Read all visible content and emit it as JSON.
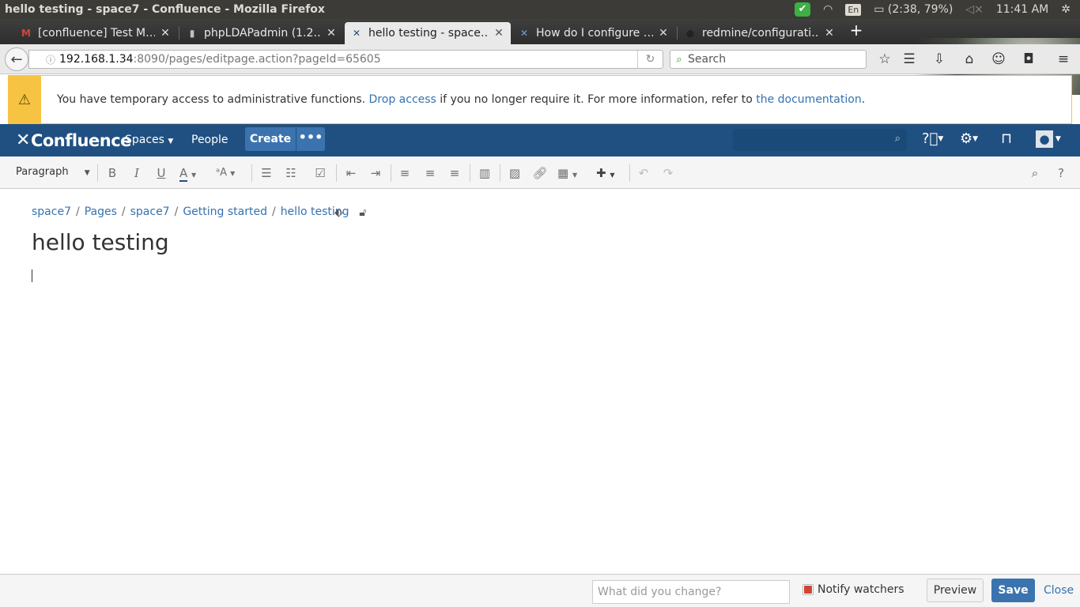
{
  "os": {
    "window_title": "hello testing - space7 - Confluence - Mozilla Firefox",
    "keyboard_layout": "En",
    "battery": "(2:38, 79%)",
    "clock": "11:41 AM"
  },
  "browser": {
    "tabs": [
      {
        "label": "[confluence] Test M…",
        "icon": "gmail-icon"
      },
      {
        "label": "phpLDAPadmin (1.2…",
        "icon": "phpldapadmin-icon"
      },
      {
        "label": "hello testing - space…",
        "icon": "confluence-icon",
        "active": true
      },
      {
        "label": "How do I configure …",
        "icon": "confluence-icon"
      },
      {
        "label": "redmine/configurati…",
        "icon": "github-icon"
      }
    ],
    "url_host": "192.168.1.34",
    "url_rest": ":8090/pages/editpage.action?pageId=65605",
    "search_placeholder": "Search"
  },
  "banner": {
    "text_before": "You have temporary access to administrative functions.",
    "link1": "Drop access",
    "text_middle": "if you no longer require it. For more information, refer to",
    "link2": "the documentation",
    "text_after": "."
  },
  "header": {
    "logo": "Confluence",
    "spaces": "Spaces",
    "people": "People",
    "create": "Create",
    "more": "•••"
  },
  "toolbar": {
    "paragraph": "Paragraph"
  },
  "breadcrumbs": [
    "space7",
    "Pages",
    "space7",
    "Getting started",
    "hello testing"
  ],
  "page": {
    "title": "hello testing"
  },
  "footer": {
    "change_placeholder": "What did you change?",
    "notify": "Notify watchers",
    "preview": "Preview",
    "save": "Save",
    "close": "Close"
  },
  "colors": {
    "header": "#205081",
    "link": "#3572b0",
    "warning": "#f6c342",
    "save": "#3b73af"
  }
}
